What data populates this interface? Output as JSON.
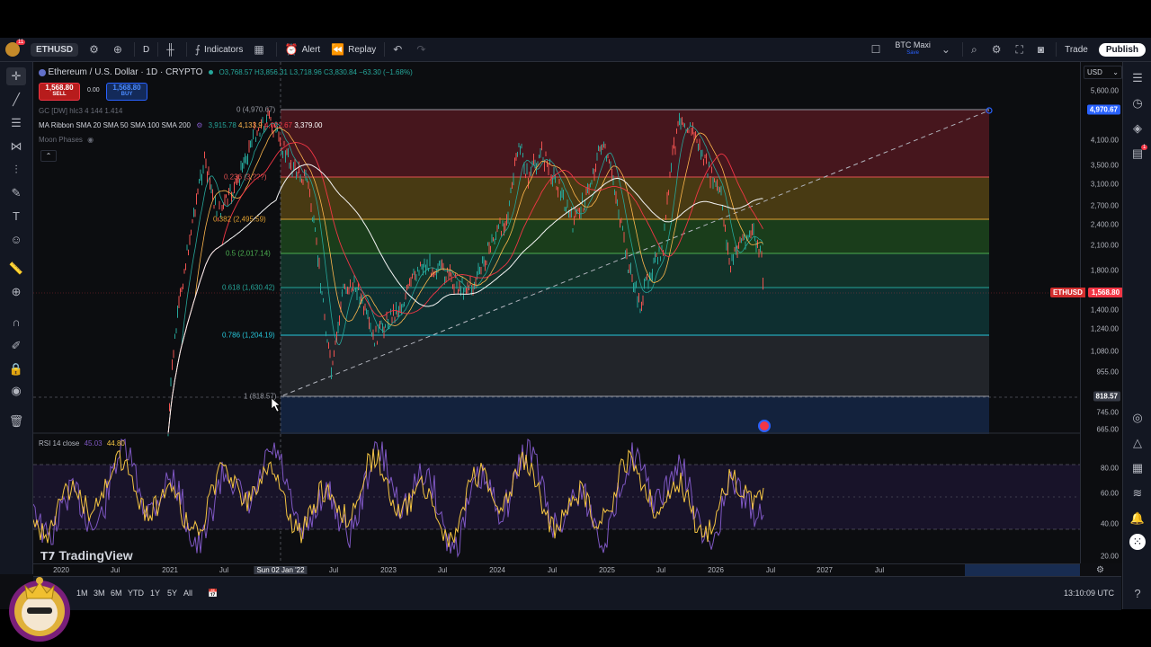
{
  "toolbar": {
    "symbol": "ETHUSD",
    "interval": "D",
    "indicators": "Indicators",
    "alert": "Alert",
    "replay": "Replay",
    "layout_name": "BTC Maxi",
    "layout_sub": "Save",
    "trade": "Trade",
    "publish": "Publish",
    "avatar_badge": "11"
  },
  "legend": {
    "title": "Ethereum / U.S. Dollar · 1D · CRYPTO",
    "ohlc": "O3,768.57 H3,856.31 L3,718.96 C3,830.84 −63.30 (−1.68%)",
    "sell_price": "1,568.80",
    "sell_label": "SELL",
    "spread": "0.00",
    "buy_price": "1,568.80",
    "buy_label": "BUY",
    "gc_line": "GC [DW] hlc3 4 144 1.414",
    "ma_title": "MA Ribbon SMA 20 SMA 50 SMA 100 SMA 200",
    "ma_v1": "3,915.78",
    "ma_v2": "4,133.9",
    "ma_v3": "4,022.67",
    "ma_v4": "3,379.00",
    "moon": "Moon Phases",
    "rsi_title": "RSI 14 close",
    "rsi_v1": "45.03",
    "rsi_v2": "44.80"
  },
  "currency": "USD",
  "price_labels": [
    "5,600.00",
    "4,100.00",
    "3,500.00",
    "3,100.00",
    "2,700.00",
    "2,400.00",
    "2,100.00",
    "1,800.00",
    "1,400.00",
    "1,240.00",
    "1,080.00",
    "955.00",
    "745.00",
    "665.00"
  ],
  "price_tags": {
    "top": "4,970.67",
    "eth_name": "ETHUSD",
    "eth": "1,568.80",
    "low": "818.57"
  },
  "rsi_labels": [
    "80.00",
    "60.00",
    "40.00",
    "20.00"
  ],
  "fib_labels": [
    {
      "text": "0 (4,970.67)",
      "color": "#9598a1"
    },
    {
      "text": "0.236 (3,???)",
      "color": "#e05050"
    },
    {
      "text": "0.382 (2,495.59)",
      "color": "#e0a030"
    },
    {
      "text": "0.5 (2,017.14)",
      "color": "#4caf50"
    },
    {
      "text": "0.618 (1,630.42)",
      "color": "#26a69a"
    },
    {
      "text": "0.786 (1,204.19)",
      "color": "#26c6da"
    },
    {
      "text": "1 (818.57)",
      "color": "#9598a1"
    }
  ],
  "time_labels": [
    "2020",
    "Jul",
    "2021",
    "Jul",
    "Sun 02 Jan '22",
    "Jul",
    "2023",
    "Jul",
    "2024",
    "Jul",
    "2025",
    "Jul",
    "2026",
    "Jul",
    "2027",
    "Jul"
  ],
  "watermark": "TradingView",
  "ranges": [
    "1M",
    "3M",
    "6M",
    "YTD",
    "1Y",
    "5Y",
    "All"
  ],
  "clock": "13:10:09 UTC",
  "notif_badge": "1"
}
